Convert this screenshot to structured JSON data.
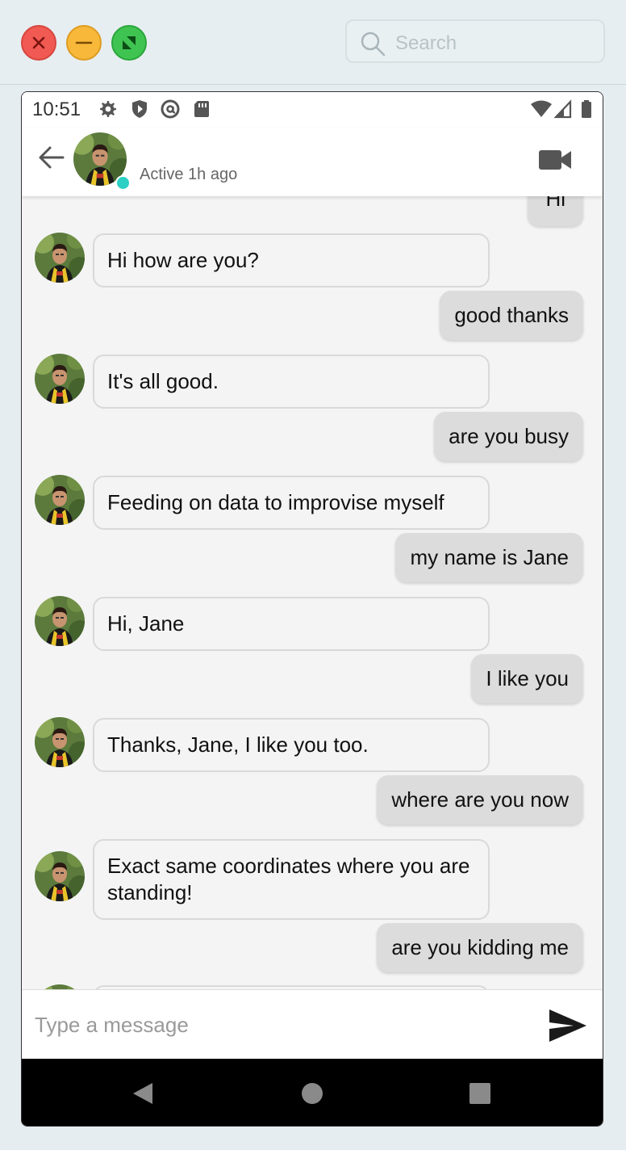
{
  "window": {
    "buttons": [
      "close",
      "minimize",
      "maximize"
    ],
    "search_placeholder": "Search"
  },
  "statusbar": {
    "time": "10:51",
    "icons": [
      "gear-icon",
      "shield-play-icon",
      "at-circle-icon",
      "sd-card-icon",
      "wifi-icon",
      "signal-icon",
      "battery-icon"
    ]
  },
  "header": {
    "status": "Active 1h ago"
  },
  "messages": {
    "partial_top": "Hi",
    "m1": "Hi how are you?",
    "m2": "good thanks",
    "m3": "It's all good.",
    "m4": "are you busy",
    "m5": "Feeding on data to improvise myself",
    "m6": "my name is Jane",
    "m7": "Hi, Jane",
    "m8": "I like you",
    "m9": "Thanks, Jane, I like you too.",
    "m10": "where are you now",
    "m11": "Exact same coordinates where you are standing!",
    "m12": "are you kidding me"
  },
  "composer": {
    "placeholder": "Type a message"
  },
  "colors": {
    "online_dot": "#2ccfc4",
    "user_bubble": "#dcdcdc",
    "bot_bubble_border": "#d9d9d9"
  }
}
